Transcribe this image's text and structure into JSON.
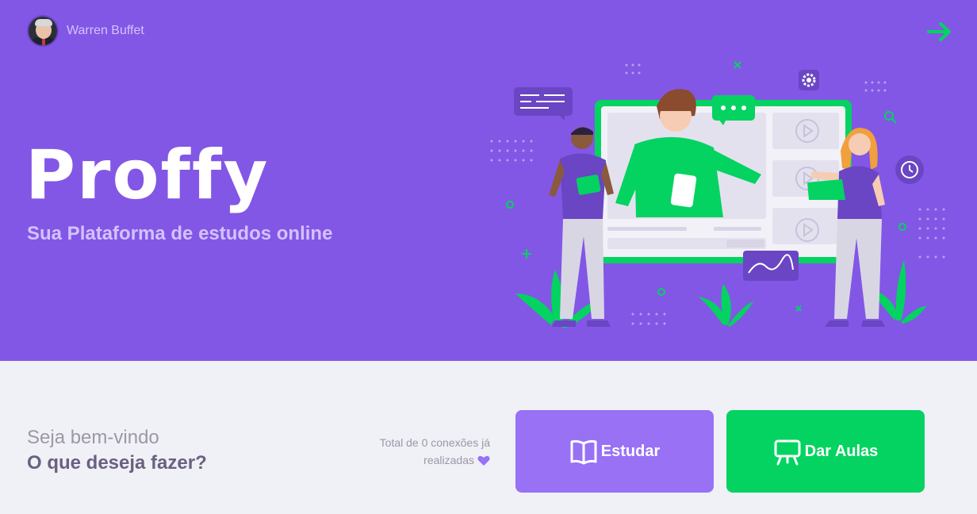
{
  "colors": {
    "primary": "#8257E5",
    "primary_light": "#9871F5",
    "secondary": "#04D361",
    "background": "#F0F0F7"
  },
  "user": {
    "name": "Warren Buffet"
  },
  "header": {
    "logout_icon": "arrow-right-icon"
  },
  "brand": {
    "logo": "Proffy",
    "tagline": "Sua Plataforma de estudos online"
  },
  "welcome": {
    "line1": "Seja bem-vindo",
    "line2": "O que deseja fazer?"
  },
  "connections": {
    "line1": "Total de 0 conexões já",
    "line2": "realizadas",
    "icon": "purple-heart-icon"
  },
  "buttons": {
    "study": {
      "label": "Estudar",
      "icon": "book-icon"
    },
    "teach": {
      "label": "Dar Aulas",
      "icon": "presentation-board-icon"
    }
  }
}
